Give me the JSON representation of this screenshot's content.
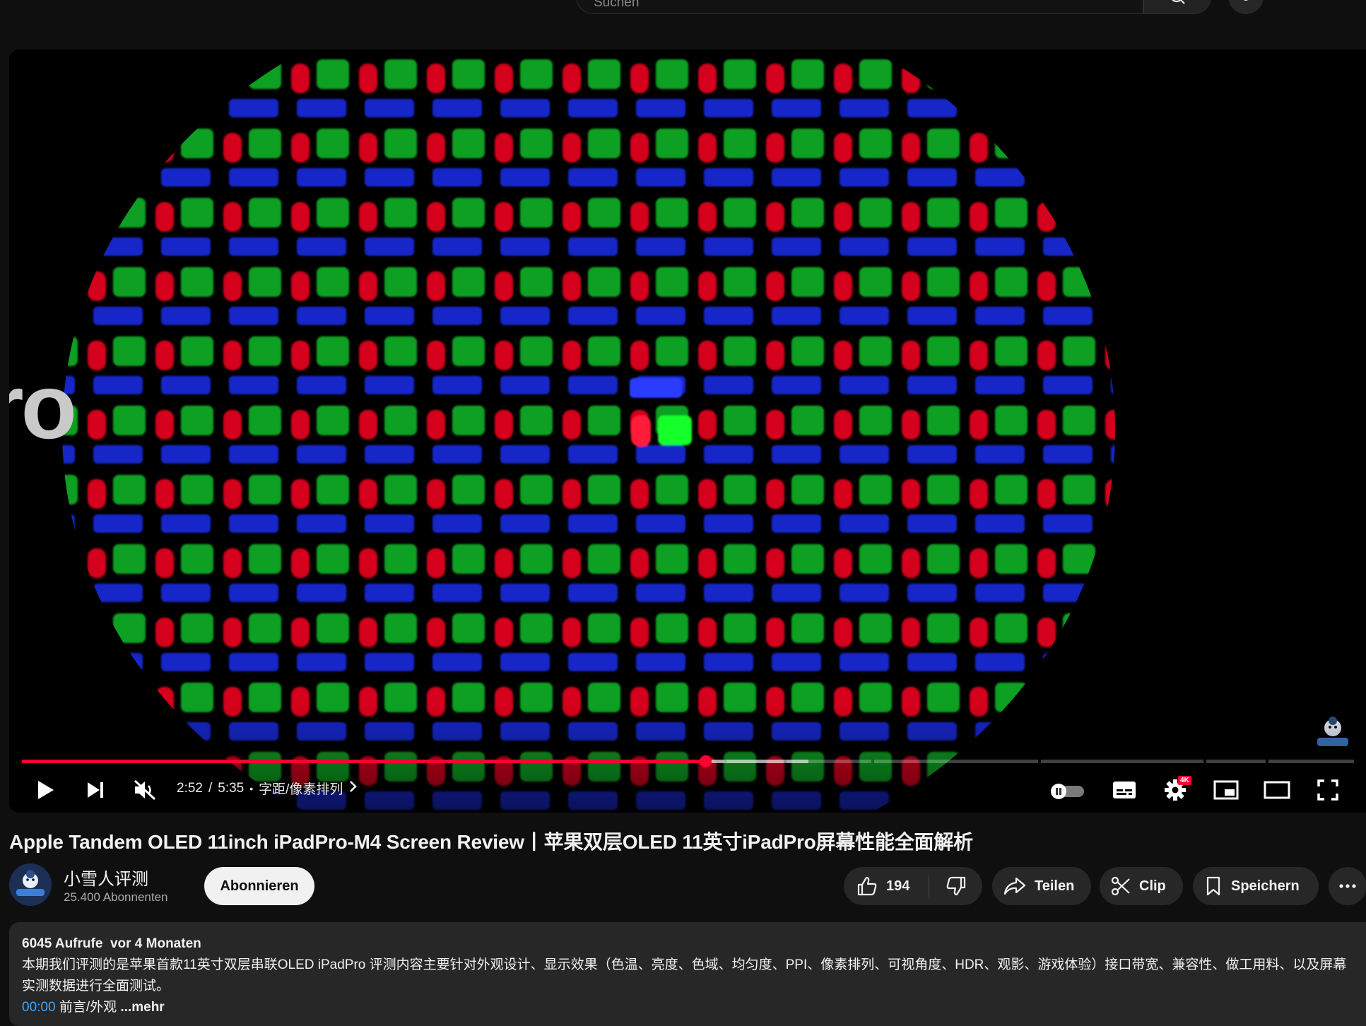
{
  "search": {
    "placeholder": "Suchen"
  },
  "video": {
    "overlay_text": "ro",
    "current_time": "2:52",
    "time_sep": "/",
    "duration": "5:35",
    "chapter": "字距/像素排列",
    "progress_fraction": 0.513,
    "settings_badge": "4K"
  },
  "title": "Apple Tandem OLED 11inch iPadPro-M4 Screen Review丨苹果双层OLED 11英寸iPadPro屏幕性能全面解析",
  "channel": {
    "name": "小雪人评测",
    "subscribers": "25.400 Abonnenten",
    "subscribe_label": "Abonnieren"
  },
  "actions": {
    "likes": "194",
    "share": "Teilen",
    "clip": "Clip",
    "save": "Speichern"
  },
  "description": {
    "views": "6045 Aufrufe",
    "age": "vor 4 Monaten",
    "body": "本期我们评测的是苹果首款11英寸双层串联OLED iPadPro 评测内容主要针对外观设计、显示效果（色温、亮度、色域、均匀度、PPI、像素排列、可视角度、HDR、观影、游戏体验）接口带宽、兼容性、做工用料、以及屏幕实测数据进行全面测试。",
    "chapter_time": "00:00",
    "chapter_title": "前言/外观",
    "more": "...mehr"
  },
  "colors": {
    "accent_red": "#ff0033",
    "link_blue": "#3ea6ff",
    "pill_bg": "#272727",
    "page_bg": "#0f0f0f"
  },
  "icons": [
    "search-icon",
    "mic-icon",
    "play-icon",
    "next-icon",
    "mute-icon",
    "chevron-right-icon",
    "autoplay-toggle",
    "subtitles-icon",
    "settings-icon",
    "miniplayer-icon",
    "theater-icon",
    "fullscreen-icon",
    "thumbs-up-icon",
    "thumbs-down-icon",
    "share-icon",
    "scissors-icon",
    "bookmark-icon",
    "more-icon"
  ]
}
